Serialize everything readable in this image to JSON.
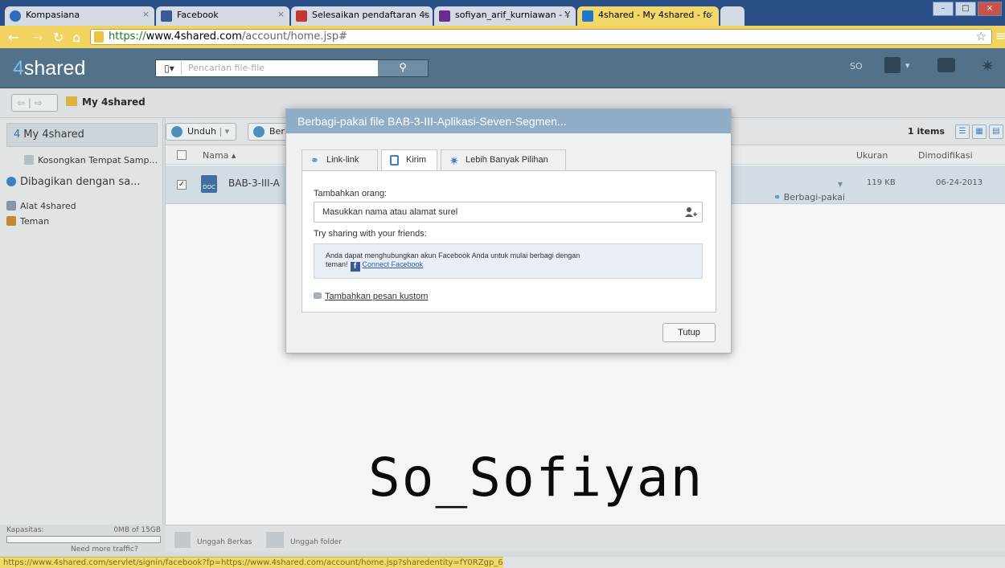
{
  "browser": {
    "tabs": [
      {
        "label": "Kompasiana",
        "icon": "kompasiana-icon",
        "color": "#2d6bbf"
      },
      {
        "label": "Facebook",
        "icon": "facebook-icon",
        "color": "#3b5998"
      },
      {
        "label": "Selesaikan pendaftaran 4s",
        "icon": "gmail-icon",
        "color": "#c23a2f"
      },
      {
        "label": "sofiyan_arif_kurniawan - Y",
        "icon": "yahoo-mail-icon",
        "color": "#6a2c91"
      },
      {
        "label": "4shared - My 4shared - fo",
        "icon": "4shared-icon",
        "color": "#1f77c9"
      }
    ],
    "url_scheme": "https://",
    "url_host": "www.4shared.com",
    "url_path": "/account/home.jsp#",
    "status_url": "https://www.4shared.com/servlet/signin/facebook?fp=https://www.4shared.com/account/home.jsp?sharedentity=fY0RZgp_6"
  },
  "header": {
    "logo_four": "4",
    "logo_text": "shared",
    "search_placeholder": "Pencarian file-file",
    "user_initials": "SO"
  },
  "breadcrumb": {
    "title": "My 4shared"
  },
  "sidebar": {
    "top_label": "My 4shared",
    "items": [
      {
        "label": "Kosongkan Tempat Samp..."
      },
      {
        "label": "Dibagikan dengan sa..."
      },
      {
        "label": "Alat 4shared"
      },
      {
        "label": "Teman"
      }
    ],
    "capacity_label": "Kapasitas:",
    "capacity_value": "0MB of 15GB",
    "more_traffic": "Need more traffic?"
  },
  "toolbar": {
    "download_label": "Unduh",
    "share_label": "Berbagi",
    "items_count": "1 items"
  },
  "table": {
    "col_name": "Nama",
    "col_size": "Ukuran",
    "col_modified": "Dimodifikasi",
    "rows": [
      {
        "name": "BAB-3-III-A",
        "share_label": "Berbagi-pakai",
        "size": "119 KB",
        "modified": "06-24-2013"
      }
    ]
  },
  "bottombar": {
    "upload_files": "Unggah Berkas",
    "upload_folder": "Unggah folder"
  },
  "dialog": {
    "title": "Berbagi-pakai file BAB-3-III-Aplikasi-Seven-Segmen...",
    "tabs": [
      {
        "label": "Link-link"
      },
      {
        "label": "Kirim"
      },
      {
        "label": "Lebih Banyak Pilihan"
      }
    ],
    "add_people_label": "Tambahkan orang:",
    "add_people_placeholder": "Masukkan nama atau alamat surel",
    "try_sharing": "Try sharing with your friends:",
    "fb_text_1": "Anda dapat menghubungkan akun Facebook Anda untuk mulai berbagi dengan",
    "fb_text_2": "teman!",
    "connect_facebook": "Connect Facebook",
    "add_message": "Tambahkan pesan kustom",
    "close_button": "Tutup"
  },
  "watermark": "So_Sofiyan",
  "colors": {
    "header_bg": "#54718a",
    "dialog_title_bg": "#90adc7",
    "selected_row": "#dbe4ec"
  }
}
